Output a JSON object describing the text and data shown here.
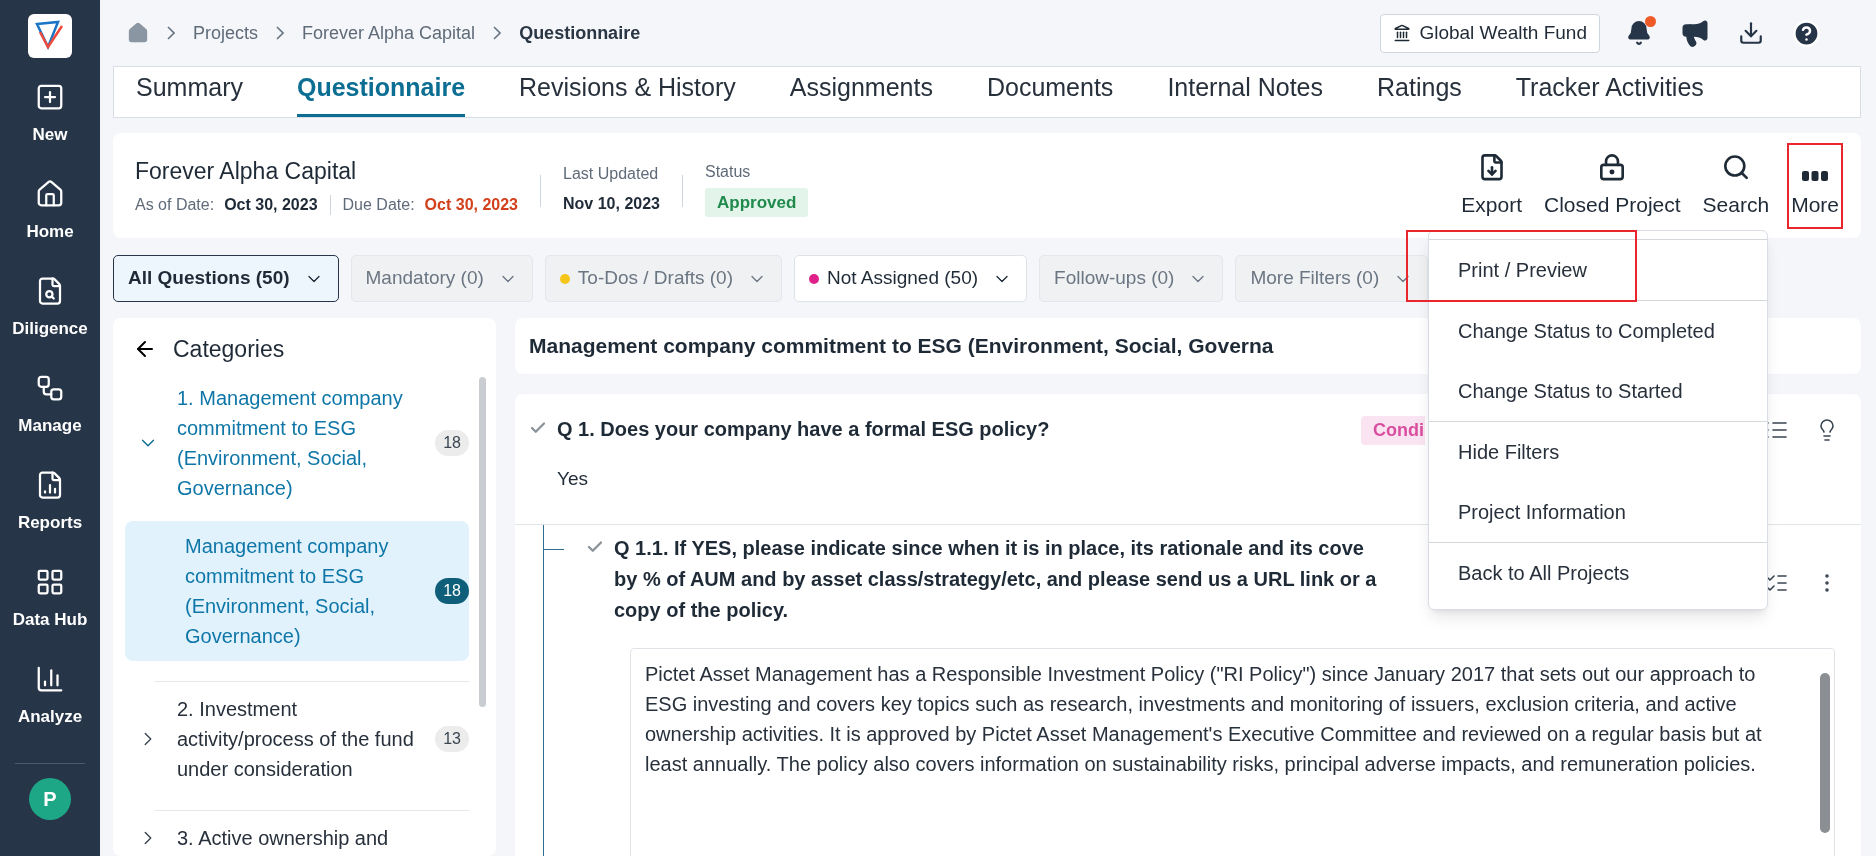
{
  "nav": {
    "items": [
      {
        "label": "New"
      },
      {
        "label": "Home"
      },
      {
        "label": "Diligence"
      },
      {
        "label": "Manage"
      },
      {
        "label": "Reports"
      },
      {
        "label": "Data Hub"
      },
      {
        "label": "Analyze"
      }
    ],
    "avatar": "P"
  },
  "breadcrumb": [
    "Projects",
    "Forever Alpha Capital",
    "Questionnaire"
  ],
  "fund_button": "Global Wealth Fund",
  "notifications": {
    "unread": true
  },
  "tabs": [
    {
      "label": "Summary",
      "selected": false
    },
    {
      "label": "Questionnaire",
      "selected": true
    },
    {
      "label": "Revisions & History",
      "selected": false
    },
    {
      "label": "Assignments",
      "selected": false
    },
    {
      "label": "Documents",
      "selected": false
    },
    {
      "label": "Internal Notes",
      "selected": false
    },
    {
      "label": "Ratings",
      "selected": false
    },
    {
      "label": "Tracker Activities",
      "selected": false
    }
  ],
  "project": {
    "name": "Forever Alpha Capital",
    "as_of_label": "As of Date:",
    "as_of": "Oct 30, 2023",
    "due_label": "Due Date:",
    "due": "Oct 30, 2023",
    "updated_label": "Last Updated",
    "updated": "Nov 10, 2023",
    "status_label": "Status",
    "status": "Approved"
  },
  "actions": [
    {
      "label": "Export",
      "highlighted": false
    },
    {
      "label": "Closed Project",
      "highlighted": false
    },
    {
      "label": "Search",
      "highlighted": false
    },
    {
      "label": "More",
      "highlighted": true
    }
  ],
  "filters": [
    {
      "label": "All Questions (50)",
      "selected": true,
      "disabled": false
    },
    {
      "label": "Mandatory (0)",
      "selected": false,
      "disabled": true
    },
    {
      "label": "To-Dos / Drafts (0)",
      "selected": false,
      "disabled": true,
      "color": "#f5c518"
    },
    {
      "label": "Not Assigned (50)",
      "selected": false,
      "disabled": false,
      "color": "#e0218a"
    },
    {
      "label": "Follow-ups (0)",
      "selected": false,
      "disabled": true
    },
    {
      "label": "More Filters (0)",
      "selected": false,
      "disabled": true
    }
  ],
  "categories": {
    "title": "Categories",
    "items": [
      {
        "label": "1. Management company commitment to ESG (Environment, Social, Governance)",
        "count": "18",
        "expanded": true,
        "selected": false,
        "children": [
          {
            "label": "Management company commitment to ESG (Environment, Social, Governance)",
            "count": "18",
            "selected": true
          }
        ]
      },
      {
        "label": "2. Investment activity/process of the fund under consideration",
        "count": "13",
        "expanded": false,
        "selected": false
      },
      {
        "label": "3. Active ownership and",
        "expanded": false,
        "selected": false
      }
    ]
  },
  "section_title": "Management company commitment to ESG (Environment, Social, Governa",
  "questions": [
    {
      "lines": [
        "Q 1. Does your company have a formal ESG policy?"
      ],
      "answered": true,
      "badge": "Condi",
      "answer": "Yes",
      "kind": "choice"
    },
    {
      "lines": [
        "Q 1.1. If YES, please indicate since when it is in place, its rationale and its cove",
        "by % of AUM and by asset class/strategy/etc, and please send us a URL link or a",
        "copy of the policy."
      ],
      "answered": true,
      "answer": "Pictet Asset Management has a Responsible Investment Policy (\"RI Policy\") since January 2017 that sets out our approach to ESG investing and covers key topics such as research, investments and monitoring of issuers, exclusion criteria, and active ownership activities. It is approved by Pictet Asset Management's Executive Committee and reviewed on a regular basis but at least annually. The policy also covers information on sustainability risks, principal adverse impacts, and remuneration policies.",
      "kind": "text"
    }
  ],
  "menu": {
    "groups": [
      [
        {
          "label": "Print / Preview",
          "highlighted": true
        }
      ],
      [
        {
          "label": "Change Status to Completed",
          "highlighted": false
        },
        {
          "label": "Change Status to Started",
          "highlighted": false
        }
      ],
      [
        {
          "label": "Hide Filters",
          "highlighted": false
        },
        {
          "label": "Project Information",
          "highlighted": false
        }
      ],
      [
        {
          "label": "Back to All Projects",
          "highlighted": false
        }
      ]
    ]
  }
}
